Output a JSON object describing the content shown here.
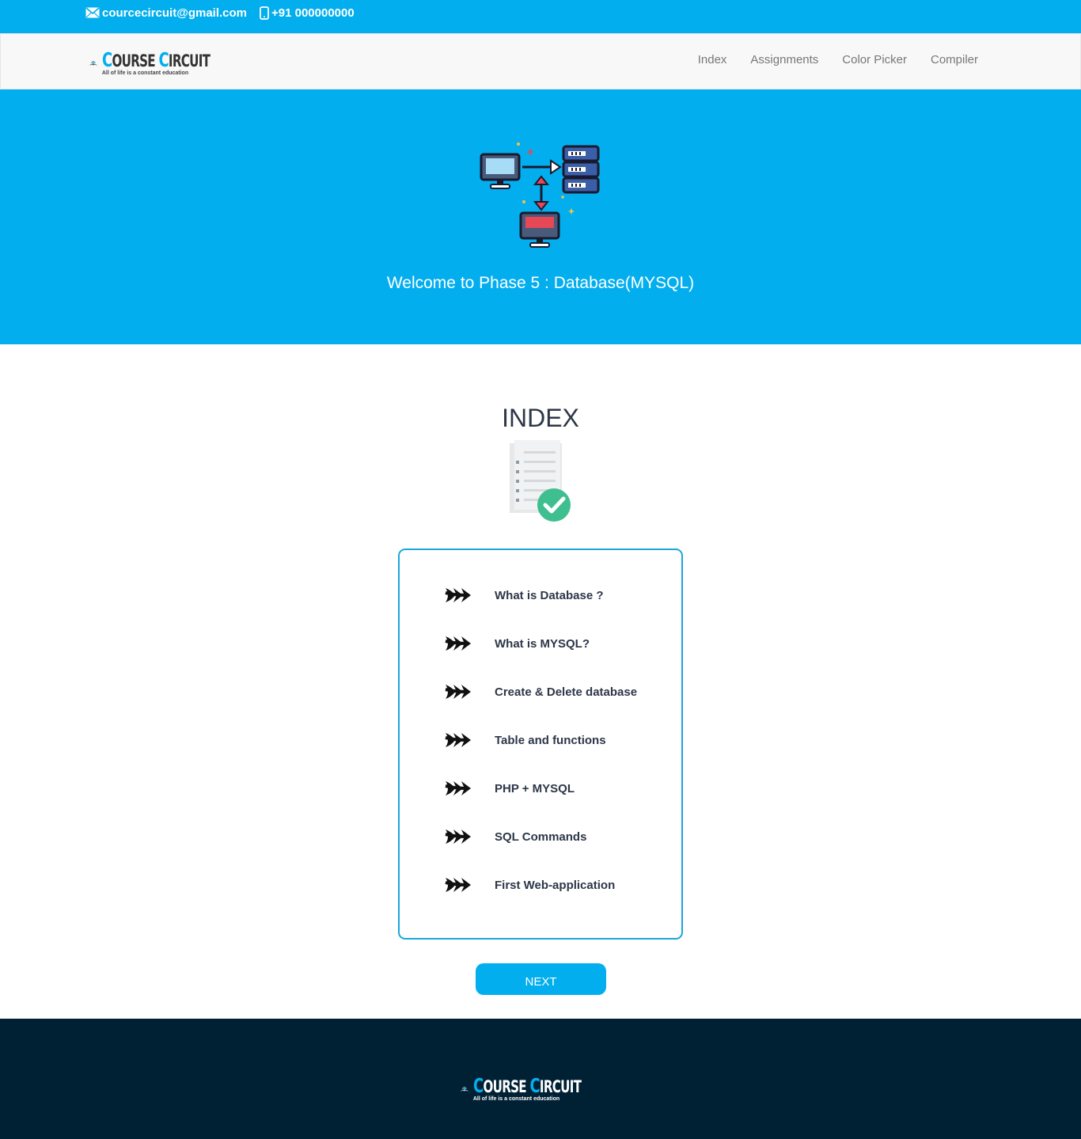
{
  "topbar": {
    "email": "courcecircuit@gmail.com",
    "phone": "+91 000000000",
    "email_icon": "envelope-icon",
    "phone_icon": "mobile-phone-icon"
  },
  "brand": {
    "name_first_letter": "C",
    "name_first_rest": "OURSE ",
    "name_second_letter": "C",
    "name_second_rest": "IRCUIT",
    "tagline": "All of life is a constant education",
    "logo_icon": "open-book-graduation-logo-icon"
  },
  "nav": {
    "items": [
      {
        "label": "Index"
      },
      {
        "label": "Assignments"
      },
      {
        "label": "Color Picker"
      },
      {
        "label": "Compiler"
      }
    ]
  },
  "hero": {
    "title": "Welcome to Phase 5 : Database(MYSQL)",
    "illustration_icon": "database-network-icon"
  },
  "index": {
    "title": "INDEX",
    "illustration_icon": "checklist-document-icon",
    "items": [
      {
        "label": "What is Database ?"
      },
      {
        "label": "What is MYSQL?"
      },
      {
        "label": "Create & Delete database"
      },
      {
        "label": "Table and functions"
      },
      {
        "label": "PHP + MYSQL"
      },
      {
        "label": "SQL Commands"
      },
      {
        "label": "First Web-application"
      }
    ]
  },
  "next_button": {
    "label": "NEXT"
  },
  "colors": {
    "primary": "#03aeee",
    "footer": "#002134",
    "text": "#2d3748"
  }
}
